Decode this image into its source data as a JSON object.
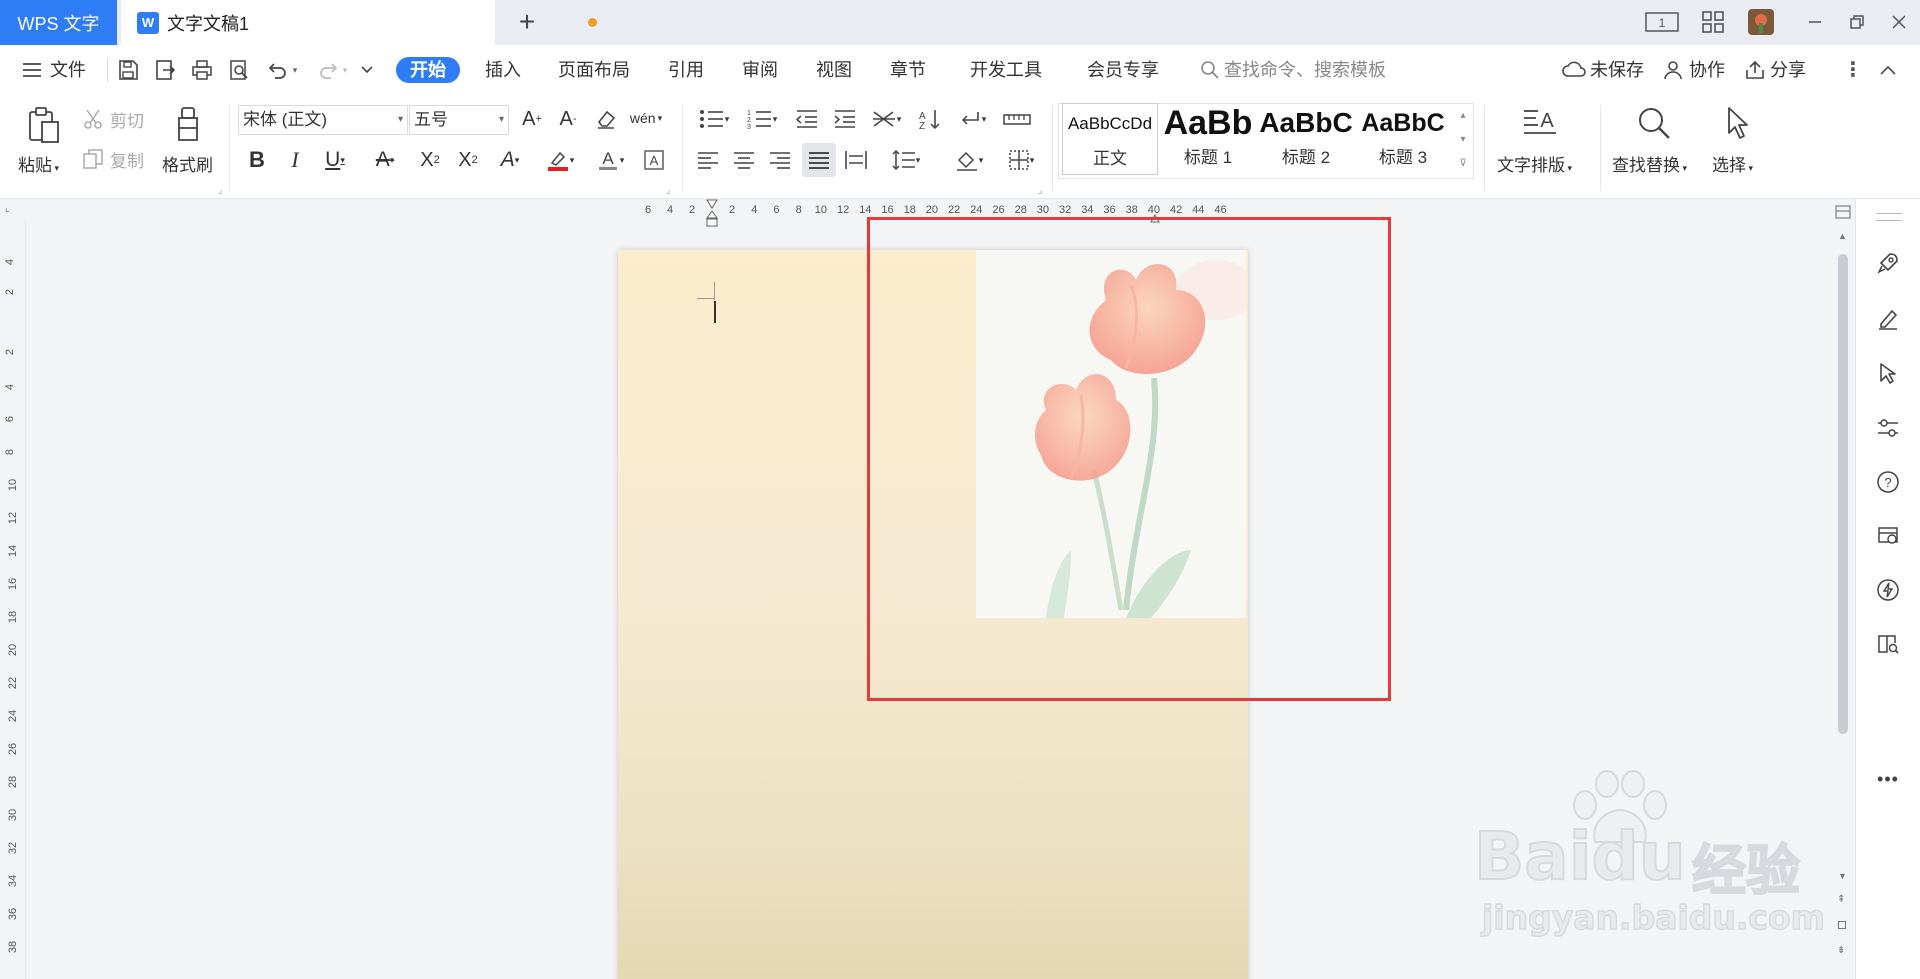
{
  "titlebar": {
    "app_name": "WPS 文字",
    "doc_title": "文字文稿1",
    "doc_icon": "W",
    "page_indicator": "1"
  },
  "menu": {
    "file": "文件",
    "items": [
      "开始",
      "插入",
      "页面布局",
      "引用",
      "审阅",
      "视图",
      "章节",
      "开发工具",
      "会员专享"
    ],
    "search_placeholder": "查找命令、搜索模板",
    "unsaved": "未保存",
    "collab": "协作",
    "share": "分享"
  },
  "ribbon": {
    "paste": "粘贴",
    "cut": "剪切",
    "copy": "复制",
    "format_painter": "格式刷",
    "font_name": "宋体 (正文)",
    "font_size": "五号",
    "phonetic": "wén",
    "styles": [
      {
        "sample": "AaBbCcDd",
        "name": "正文"
      },
      {
        "sample": "AaBb",
        "name": "标题 1"
      },
      {
        "sample": "AaBbC",
        "name": "标题 2"
      },
      {
        "sample": "AaBbC",
        "name": "标题 3"
      }
    ],
    "text_layout": "文字排版",
    "find_replace": "查找替换",
    "select": "选择"
  },
  "ruler": {
    "h_left": [
      "6",
      "4",
      "2"
    ],
    "h_right": [
      "2",
      "4",
      "6",
      "8",
      "10",
      "12",
      "14",
      "16",
      "18",
      "20",
      "22",
      "24",
      "26",
      "28",
      "30",
      "32",
      "34",
      "36",
      "38",
      "40",
      "42",
      "44",
      "46"
    ],
    "v": [
      "4",
      "2",
      "2",
      "4",
      "6",
      "8",
      "10",
      "12",
      "14",
      "16",
      "18",
      "20",
      "22",
      "24",
      "26",
      "28",
      "30",
      "32",
      "34",
      "36",
      "38"
    ]
  },
  "watermark": {
    "brand": "Baidu",
    "brand_cn": "经验",
    "url": "jingyan.baidu.com"
  },
  "colors": {
    "accent": "#2e7cf6",
    "highlight_border": "#e43a3a",
    "page_top": "#fdecce",
    "page_bottom": "#e5d6b2",
    "tulip": "#f59a8a"
  }
}
